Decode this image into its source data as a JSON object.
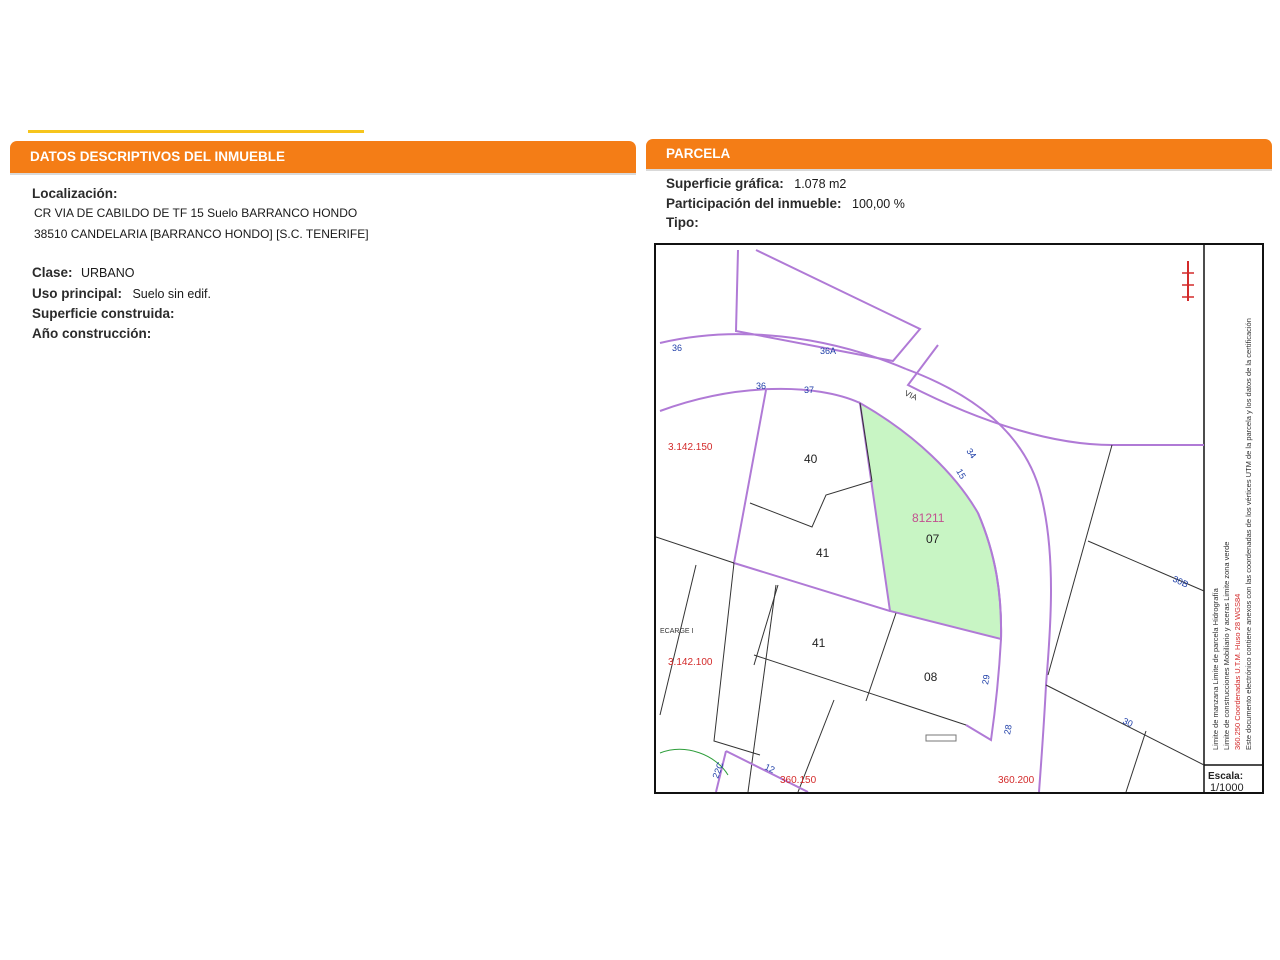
{
  "left_panel": {
    "title": "DATOS DESCRIPTIVOS DEL INMUEBLE",
    "localizacion_label": "Localización:",
    "address_line1": "CR VIA DE CABILDO DE TF 15 Suelo BARRANCO HONDO",
    "address_line2": "38510 CANDELARIA [BARRANCO HONDO] [S.C. TENERIFE]",
    "clase_label": "Clase:",
    "clase_value": "URBANO",
    "uso_label": "Uso principal:",
    "uso_value": "Suelo sin edif.",
    "superficie_label": "Superficie construida:",
    "anio_label": "Año construcción:"
  },
  "right_panel": {
    "title": "PARCELA",
    "superficie_label": "Superficie gráfica:",
    "superficie_value": "1.078 m2",
    "participacion_label": "Participación del inmueble:",
    "participacion_value": "100,00 %",
    "tipo_label": "Tipo:"
  },
  "map": {
    "coord_y_top": "3.142.150",
    "coord_y_bottom": "3.142.100",
    "coord_x_left": "360.150",
    "coord_x_right": "360.200",
    "parcel_ref": "81211",
    "parcel_number": "07",
    "lot_labels": [
      "40",
      "41",
      "41",
      "08"
    ],
    "street_numbers": [
      "36",
      "36A",
      "36",
      "37",
      "34",
      "15",
      "30B",
      "29",
      "30",
      "28",
      "12",
      "22C"
    ],
    "street_label": "VIA",
    "place_label": "ECARGE I",
    "escala_label": "Escala:",
    "escala_value": "1/1000",
    "legend_line1": "Limite de manzana  Limite de parcela  Hidrografía",
    "legend_line2": "Limite de construcciones  Mobiliario y aceras  Limite zona verde",
    "legend_line3": "360.250 Coordenadas U.T.M. Huso 28 WGS84",
    "legend_line4": "Este documento electrónico contiene anexos con las coordenadas de los vértices UTM de la parcela y los datos de la certificación",
    "colors": {
      "parcel_fill": "#c8f5c4",
      "manzana_line": "#b07ad6",
      "coord_text": "#d32a2a",
      "street_num": "#1f3fa8",
      "banner": "#f47d16"
    }
  }
}
